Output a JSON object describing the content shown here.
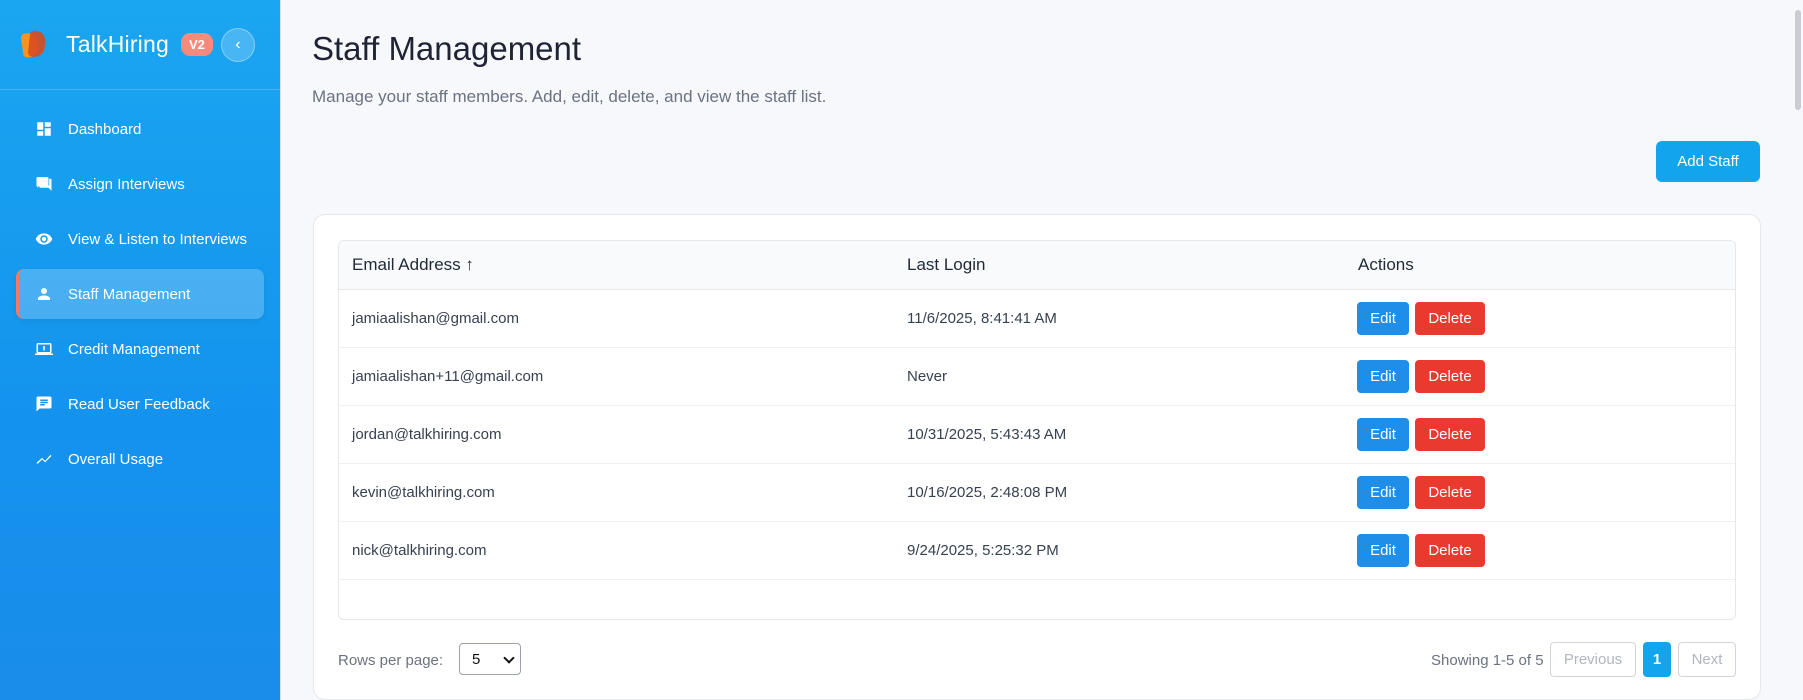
{
  "brand": {
    "name": "TalkHiring",
    "badge": "V2"
  },
  "sidebar": {
    "items": [
      {
        "label": "Dashboard",
        "icon": "dashboard-icon"
      },
      {
        "label": "Assign Interviews",
        "icon": "chat-icon"
      },
      {
        "label": "View & Listen to Interviews",
        "icon": "eye-icon"
      },
      {
        "label": "Staff Management",
        "icon": "person-icon",
        "active": true
      },
      {
        "label": "Credit Management",
        "icon": "computer-icon"
      },
      {
        "label": "Read User Feedback",
        "icon": "feedback-icon"
      },
      {
        "label": "Overall Usage",
        "icon": "trending-icon"
      }
    ]
  },
  "page": {
    "title": "Staff Management",
    "subtitle": "Manage your staff members. Add, edit, delete, and view the staff list.",
    "add_button": "Add Staff"
  },
  "table": {
    "headers": {
      "email": "Email Address ↑",
      "last_login": "Last Login",
      "actions": "Actions"
    },
    "rows": [
      {
        "email": "jamiaalishan@gmail.com",
        "last_login": "11/6/2025, 8:41:41 AM"
      },
      {
        "email": "jamiaalishan+11@gmail.com",
        "last_login": "Never"
      },
      {
        "email": "jordan@talkhiring.com",
        "last_login": "10/31/2025, 5:43:43 AM"
      },
      {
        "email": "kevin@talkhiring.com",
        "last_login": "10/16/2025, 2:48:08 PM"
      },
      {
        "email": "nick@talkhiring.com",
        "last_login": "9/24/2025, 5:25:32 PM"
      }
    ],
    "edit_label": "Edit",
    "delete_label": "Delete"
  },
  "pagination": {
    "rows_per_page_label": "Rows per page:",
    "rows_per_page_value": "5",
    "showing": "Showing 1-5 of 5",
    "previous": "Previous",
    "current_page": "1",
    "next": "Next"
  },
  "colors": {
    "accent": "#12a4ec",
    "edit": "#1e8ee9",
    "delete": "#ea3a2f",
    "active_marker": "#f27a66"
  }
}
